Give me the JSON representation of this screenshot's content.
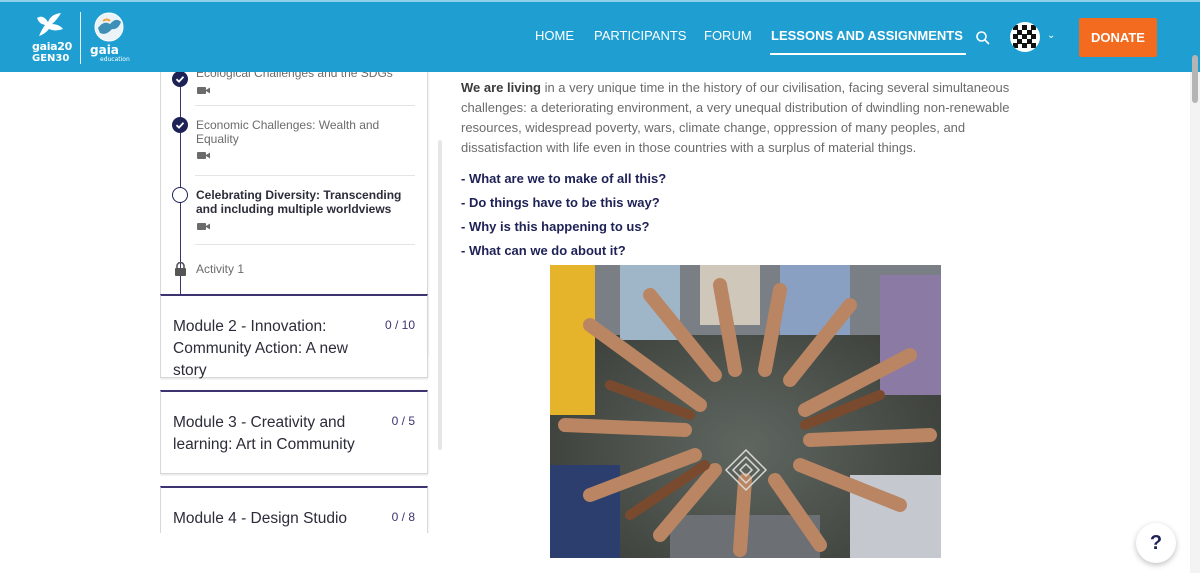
{
  "header": {
    "logo_gaia20": {
      "line1": "gaia20",
      "line2": "GEN30"
    },
    "logo_gaia_education": {
      "line1": "gaia",
      "line2": "education"
    },
    "nav": [
      "HOME",
      "PARTICIPANTS",
      "FORUM",
      "LESSONS AND ASSIGNMENTS"
    ],
    "active_nav": "LESSONS AND ASSIGNMENTS",
    "search_icon": "search-icon",
    "avatar_icon": "avatar",
    "donate_label": "DONATE",
    "colors": {
      "bar": "#1f9fd1",
      "donate": "#f26b1f"
    }
  },
  "sidebar": {
    "lessons": [
      {
        "title": "Ecological Challenges and the SDGs",
        "status": "done",
        "icon": "video-icon"
      },
      {
        "title": "Economic Challenges: Wealth and Equality",
        "status": "done",
        "icon": "video-icon"
      },
      {
        "title": "Celebrating Diversity: Transcending and including multiple worldviews",
        "status": "current",
        "icon": "video-icon"
      }
    ],
    "activity": {
      "label": "Activity 1",
      "icon": "lock-icon"
    },
    "modules": [
      {
        "title": "Module 2 - Innovation: Community Action: A new story",
        "count": "0 / 10"
      },
      {
        "title": "Module 3 - Creativity and learning: Art in Community",
        "count": "0 / 5"
      },
      {
        "title": "Module 4 - Design Studio",
        "count": "0 / 8"
      }
    ]
  },
  "main": {
    "intro_bold": "We are living",
    "intro_rest": " in a very unique time in the history of our civilisation, facing several simultaneous challenges: a deteriorating environment, a very unequal distribution of dwindling non-renewable resources, widespread poverty, wars, climate change, oppression of many peoples, and dissatisfaction with life even in those countries with a surplus of material things.",
    "questions": [
      "-  What are we to make of all this?",
      "-  Do things have to be this way?",
      "-  Why is this happening to us?",
      "-  What can we do about it?"
    ]
  },
  "help_label": "?"
}
